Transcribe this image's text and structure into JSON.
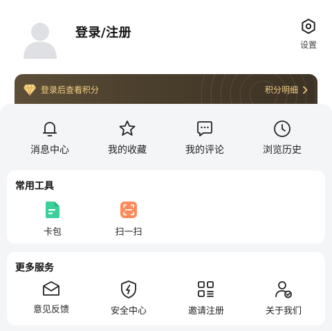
{
  "header": {
    "login_title": "登录/注册",
    "settings_label": "设置"
  },
  "points": {
    "hint": "登录后查看积分",
    "detail_link": "积分明细",
    "accent_color": "#f2cf85"
  },
  "quick_actions": [
    {
      "label": "消息中心",
      "icon": "bell-icon"
    },
    {
      "label": "我的收藏",
      "icon": "star-icon"
    },
    {
      "label": "我的评论",
      "icon": "comment-icon"
    },
    {
      "label": "浏览历史",
      "icon": "clock-icon"
    }
  ],
  "tools": {
    "title": "常用工具",
    "items": [
      {
        "label": "卡包",
        "icon": "card-wallet-icon",
        "color": "#3ccf9a"
      },
      {
        "label": "扫一扫",
        "icon": "scan-icon",
        "color": "#ff8a5c"
      }
    ]
  },
  "services": {
    "title": "更多服务",
    "items": [
      {
        "label": "意见反馈",
        "icon": "mail-icon"
      },
      {
        "label": "安全中心",
        "icon": "shield-icon"
      },
      {
        "label": "邀请注册",
        "icon": "grid-invite-icon"
      },
      {
        "label": "关于我们",
        "icon": "user-check-icon"
      }
    ]
  }
}
